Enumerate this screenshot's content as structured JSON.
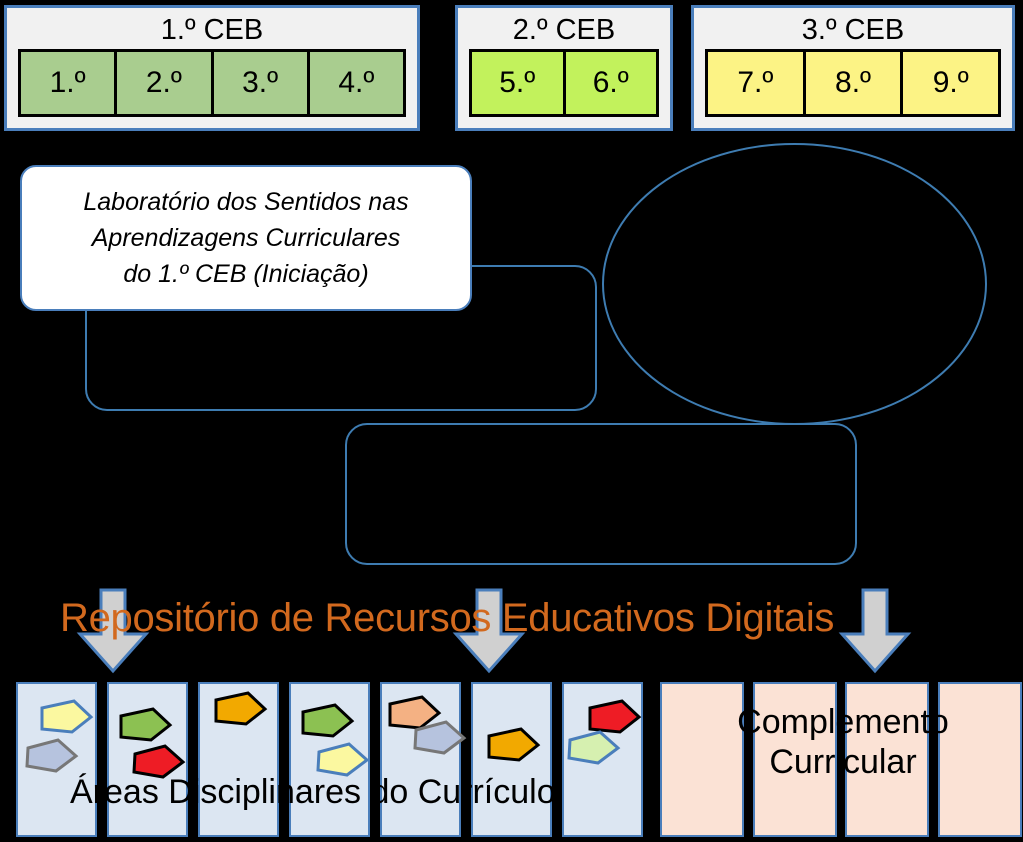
{
  "diagram": {
    "background_color": "#000000",
    "accent_blue": "#4A7EBB",
    "accent_orange": "#D2691E"
  },
  "cycles": [
    {
      "name": "cycle-1",
      "title": "1.º CEB",
      "fill": "#A9CD8F",
      "years": [
        "1.º",
        "2.º",
        "3.º",
        "4.º"
      ]
    },
    {
      "name": "cycle-2",
      "title": "2.º CEB",
      "fill": "#C2F25C",
      "years": [
        "5.º",
        "6.º"
      ]
    },
    {
      "name": "cycle-3",
      "title": "3.º CEB",
      "fill": "#FCF385",
      "years": [
        "7.º",
        "8.º",
        "9.º"
      ]
    }
  ],
  "lab_box": {
    "line1": "Laboratório dos Sentidos nas",
    "line2": "Aprendizagens Curriculares",
    "line3": "do 1.º CEB (Iniciação)"
  },
  "outlined_shapes": [
    {
      "name": "rounded-rect-left",
      "label": ""
    },
    {
      "name": "ellipse-right",
      "label": ""
    },
    {
      "name": "rounded-rect-bottom",
      "label": ""
    }
  ],
  "repository": {
    "title": "Repositório de Recursos Educativos Digitais",
    "color": "#D2691E"
  },
  "arrows": [
    {
      "name": "down-arrow-left"
    },
    {
      "name": "down-arrow-center"
    },
    {
      "name": "down-arrow-right"
    }
  ],
  "bottom": {
    "label_left": "Áreas Disciplinares do Currículo",
    "label_right_line1": "Complemento",
    "label_right_line2": "Curricular",
    "cards": [
      {
        "name": "card-1",
        "type": "blue",
        "shapes": [
          {
            "fill": "#FBF8A0",
            "stroke": "#4A7EBB"
          },
          {
            "fill": "#B6C3DE",
            "stroke": "#777777"
          }
        ]
      },
      {
        "name": "card-2",
        "type": "blue",
        "shapes": [
          {
            "fill": "#8CC152",
            "stroke": "#000000"
          },
          {
            "fill": "#EE1C25",
            "stroke": "#000000"
          }
        ]
      },
      {
        "name": "card-3",
        "type": "blue",
        "shapes": [
          {
            "fill": "#F2A900",
            "stroke": "#000000"
          }
        ]
      },
      {
        "name": "card-4",
        "type": "blue",
        "shapes": [
          {
            "fill": "#8CC152",
            "stroke": "#000000"
          },
          {
            "fill": "#FBF8A0",
            "stroke": "#4A7EBB"
          }
        ]
      },
      {
        "name": "card-5",
        "type": "blue",
        "shapes": [
          {
            "fill": "#F4B183",
            "stroke": "#000000"
          },
          {
            "fill": "#B6C3DE",
            "stroke": "#777777"
          }
        ]
      },
      {
        "name": "card-6",
        "type": "blue",
        "shapes": [
          {
            "fill": "#F2A900",
            "stroke": "#000000"
          }
        ]
      },
      {
        "name": "card-7",
        "type": "blue",
        "shapes": [
          {
            "fill": "#EE1C25",
            "stroke": "#000000"
          },
          {
            "fill": "#D6F0B0",
            "stroke": "#4A7EBB"
          }
        ]
      },
      {
        "name": "card-8",
        "type": "peach",
        "shapes": []
      },
      {
        "name": "card-9",
        "type": "peach",
        "shapes": []
      },
      {
        "name": "card-10",
        "type": "peach",
        "shapes": []
      },
      {
        "name": "card-11",
        "type": "peach",
        "shapes": []
      }
    ]
  }
}
